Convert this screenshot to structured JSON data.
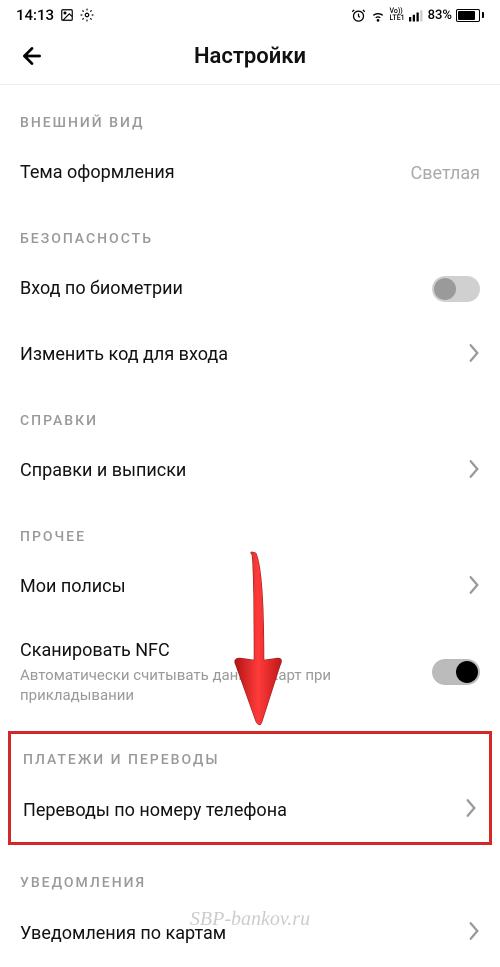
{
  "status": {
    "time": "14:13",
    "battery": "83%"
  },
  "header": {
    "title": "Настройки"
  },
  "sections": {
    "appearance": {
      "header": "ВНЕШНИЙ ВИД",
      "theme_label": "Тема оформления",
      "theme_value": "Светлая"
    },
    "security": {
      "header": "БЕЗОПАСНОСТЬ",
      "biometric_label": "Вход по биометрии",
      "change_code_label": "Изменить код для входа"
    },
    "references": {
      "header": "СПРАВКИ",
      "statements_label": "Справки и выписки"
    },
    "other": {
      "header": "ПРОЧЕЕ",
      "policies_label": "Мои полисы",
      "nfc_label": "Сканировать NFC",
      "nfc_subtitle": "Автоматически считывать данные карт при прикладывании"
    },
    "payments": {
      "header": "ПЛАТЕЖИ И ПЕРЕВОДЫ",
      "by_phone_label": "Переводы по номеру телефона"
    },
    "notifications": {
      "header": "УВЕДОМЛЕНИЯ",
      "cards_label": "Уведомления по картам"
    }
  },
  "watermark": "SBP-bankov.ru"
}
